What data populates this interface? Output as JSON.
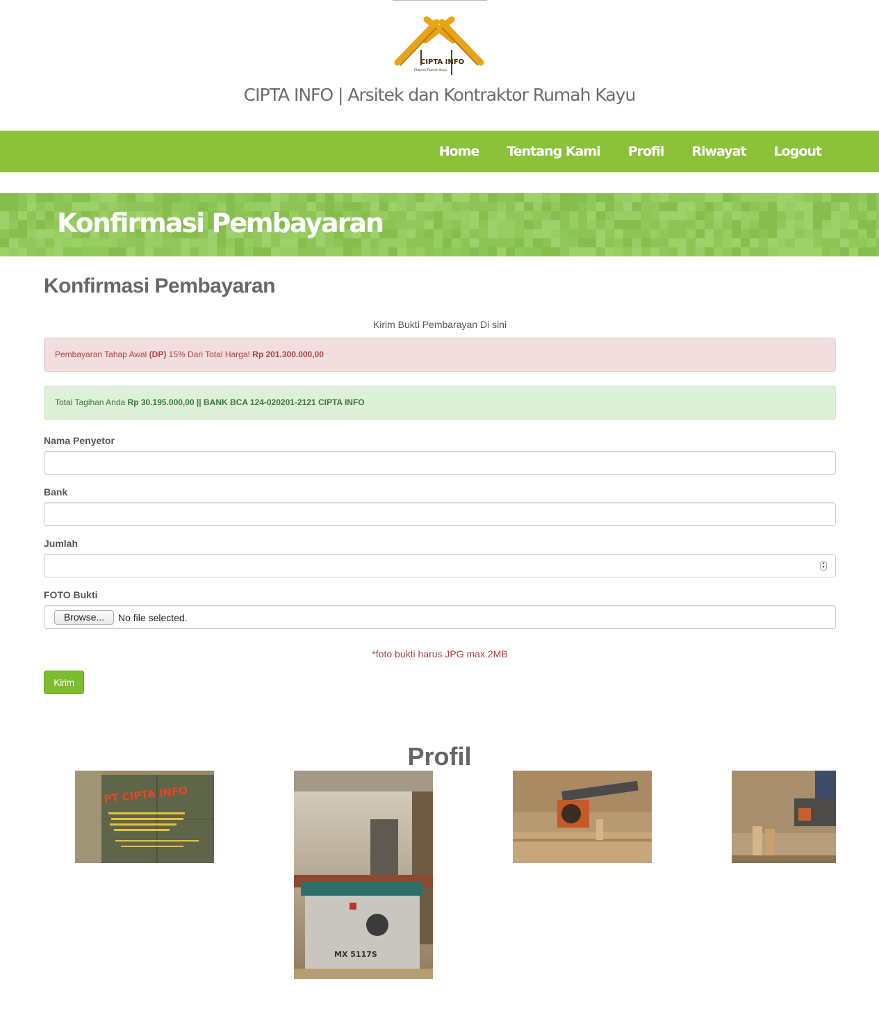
{
  "header": {
    "logo_alt": "CIPTA INFO",
    "logo_text": "CIPTA INFO",
    "logo_subtext": "Properti Rumah Kayu",
    "site_title": "CIPTA INFO | Arsitek dan Kontraktor Rumah Kayu"
  },
  "nav": {
    "items": [
      {
        "label": "Home"
      },
      {
        "label": "Tentang Kami"
      },
      {
        "label": "Profil"
      },
      {
        "label": "Riwayat"
      },
      {
        "label": "Logout"
      }
    ],
    "bg_color": "#8bc23a"
  },
  "banner": {
    "title": "Konfirmasi Pembayaran",
    "bg_color": "#92c95c"
  },
  "main": {
    "heading": "Konfirmasi Pembayaran",
    "intro": "Kirim Bukti Pembarayan Di sini",
    "alert_danger": {
      "prefix": "Pembayaran Tahap Awal ",
      "dp": "(DP)",
      "middle": " 15% Dari Total Harga! ",
      "amount": "Rp 201.300.000,00"
    },
    "alert_success": {
      "prefix": "Total Tagihan Anda ",
      "amount": "Rp 30.195.000,00 || BANK BCA 124-020201-2121 CIPTA INFO"
    },
    "form": {
      "nama_label": "Nama Penyetor",
      "nama_value": "",
      "bank_label": "Bank",
      "bank_value": "",
      "jumlah_label": "Jumlah",
      "jumlah_value": "",
      "foto_label": "FOTO Bukti",
      "browse_label": "Browse...",
      "file_status": "No file selected.",
      "note": "*foto bukti harus JPG max 2MB",
      "submit_label": "Kirim"
    }
  },
  "profil": {
    "heading": "Profil",
    "photos": [
      {
        "name": "workshop-sign-photo",
        "sign_text": "PT CIPTA INFO"
      },
      {
        "name": "shaper-machine-photo",
        "machine_label": "MX 5117S"
      },
      {
        "name": "radial-saw-photo"
      },
      {
        "name": "wood-pieces-photo"
      }
    ]
  },
  "colors": {
    "accent": "#8bc23a",
    "danger": "#a94442",
    "success": "#3c763d",
    "button": "#7cbd2f"
  }
}
